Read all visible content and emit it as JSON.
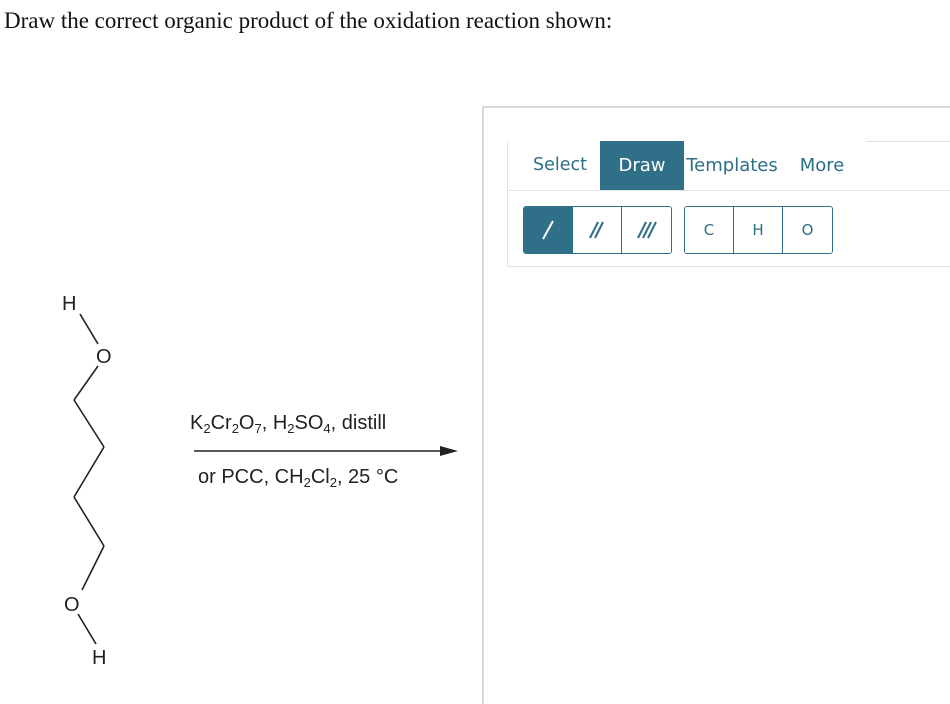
{
  "question": "Draw the correct organic product of the oxidation reaction shown:",
  "molecule": {
    "top_h": "H",
    "top_o": "O",
    "bottom_o": "O",
    "bottom_h": "H"
  },
  "reagents": {
    "line1": {
      "k": "K",
      "k2": "2",
      "cr": "Cr",
      "cr2": "2",
      "o": "O",
      "o7": "7",
      "sep1": ", H",
      "h2": "2",
      "so": "SO",
      "so4": "4",
      "rest": ", distill"
    },
    "line2": {
      "pre": "or PCC, CH",
      "ch2": "2",
      "cl": "Cl",
      "cl2": "2",
      "rest": ", 25 °C"
    }
  },
  "editor": {
    "tabs": [
      "Select",
      "Draw",
      "Templates",
      "More"
    ],
    "active_tab": "Draw",
    "bond_tools": [
      "single-bond",
      "double-bond",
      "triple-bond"
    ],
    "active_bond": "single-bond",
    "atoms": [
      "C",
      "H",
      "O"
    ]
  },
  "colors": {
    "accent": "#2f6f88",
    "tab_text": "#2d6e87",
    "border": "#d9d9d9"
  }
}
